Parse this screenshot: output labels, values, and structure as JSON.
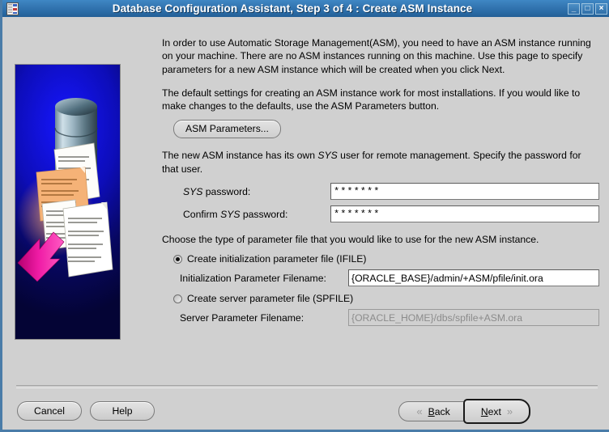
{
  "window": {
    "title": "Database Configuration Assistant, Step 3 of 4 : Create ASM Instance",
    "app_icon": "database-assistant-icon",
    "controls": {
      "minimize": "_",
      "maximize": "□",
      "close": "×"
    },
    "colors": {
      "titlebar_blue": "#3578b4",
      "background_gray": "#d0d0d0",
      "artwork_blue": "#0d0db8",
      "artwork_arrow_magenta": "#e3009b"
    }
  },
  "artwork": {
    "alt": "database cylinder with document pages and pink arrow",
    "name": "asm-illustration"
  },
  "body": {
    "intro_paragraph": "In order to use Automatic Storage Management(ASM), you need to have an ASM instance running on your machine. There are no ASM instances running on this machine. Use this page to specify parameters for a new ASM instance which will be created when you click Next.",
    "defaults_paragraph": "The default settings for creating an ASM instance work for most installations. If you would like to make changes to the defaults, use the ASM Parameters button.",
    "asm_parameters_button": "ASM Parameters...",
    "sys_paragraph_part1": "The new ASM instance has its own ",
    "sys_paragraph_italic": "SYS",
    "sys_paragraph_part2": " user for remote management. Specify the password for that user.",
    "sys_password": {
      "label_prefix": "",
      "label_italic": "SYS",
      "label_suffix": " password:",
      "value": "*******"
    },
    "confirm_sys_password": {
      "label_prefix": "Confirm ",
      "label_italic": "SYS",
      "label_suffix": " password:",
      "value": "*******"
    },
    "parameter_file_paragraph": "Choose the type of parameter file that you would like to use for the new ASM instance.",
    "radio_ifile": {
      "label": "Create initialization parameter file (IFILE)",
      "selected": true
    },
    "ifile_field": {
      "label": "Initialization Parameter Filename:",
      "value": "{ORACLE_BASE}/admin/+ASM/pfile/init.ora",
      "disabled": false
    },
    "radio_spfile": {
      "label": "Create server parameter file (SPFILE)",
      "selected": false
    },
    "spfile_field": {
      "label": "Server Parameter Filename:",
      "value": "{ORACLE_HOME}/dbs/spfile+ASM.ora",
      "disabled": true
    }
  },
  "footer": {
    "cancel": "Cancel",
    "help": "Help",
    "back": "Back",
    "back_mnemonic": "B",
    "back_rest": "ack",
    "next": "Next",
    "next_mnemonic": "N",
    "next_rest": "ext",
    "back_chevron": "«",
    "next_chevron": "»"
  }
}
